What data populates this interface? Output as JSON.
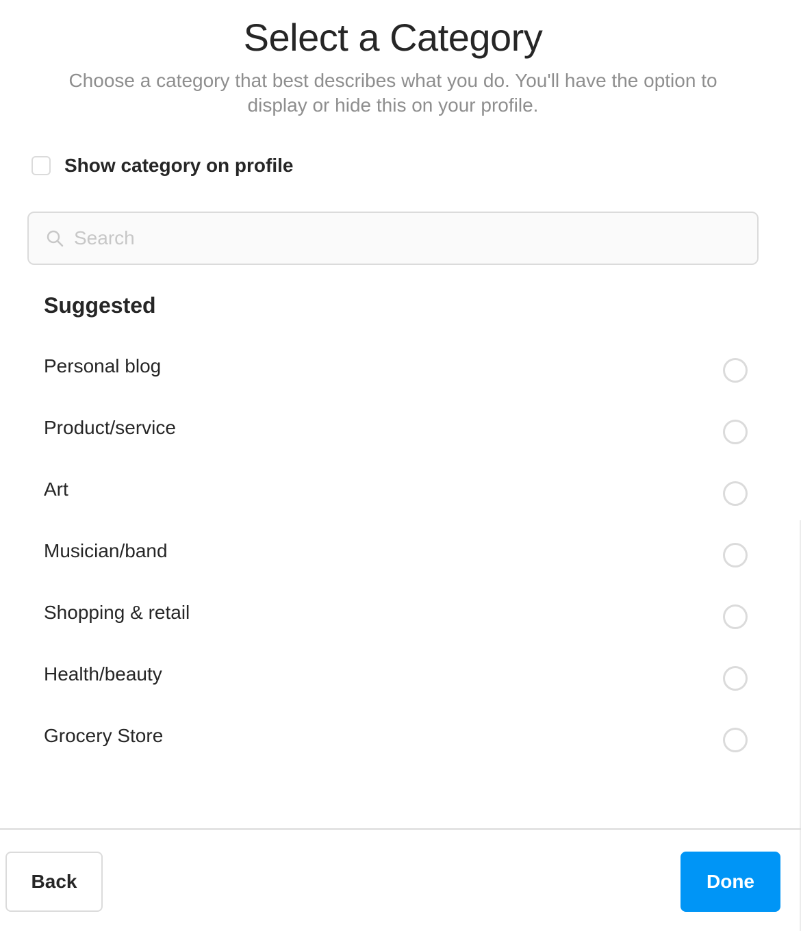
{
  "header": {
    "title": "Select a Category",
    "subtitle": "Choose a category that best describes what you do. You'll have the option to display or hide this on your profile."
  },
  "show_category": {
    "label": "Show category on profile",
    "checked": false
  },
  "search": {
    "placeholder": "Search",
    "value": "",
    "icon": "search-icon"
  },
  "suggested": {
    "heading": "Suggested",
    "items": [
      {
        "label": "Personal blog",
        "selected": false
      },
      {
        "label": "Product/service",
        "selected": false
      },
      {
        "label": "Art",
        "selected": false
      },
      {
        "label": "Musician/band",
        "selected": false
      },
      {
        "label": "Shopping & retail",
        "selected": false
      },
      {
        "label": "Health/beauty",
        "selected": false
      },
      {
        "label": "Grocery Store",
        "selected": false
      }
    ]
  },
  "footer": {
    "back_label": "Back",
    "done_label": "Done"
  },
  "colors": {
    "accent": "#0095f6",
    "text_primary": "#262626",
    "text_secondary": "#8e8e8e",
    "border": "#dbdbdb"
  }
}
